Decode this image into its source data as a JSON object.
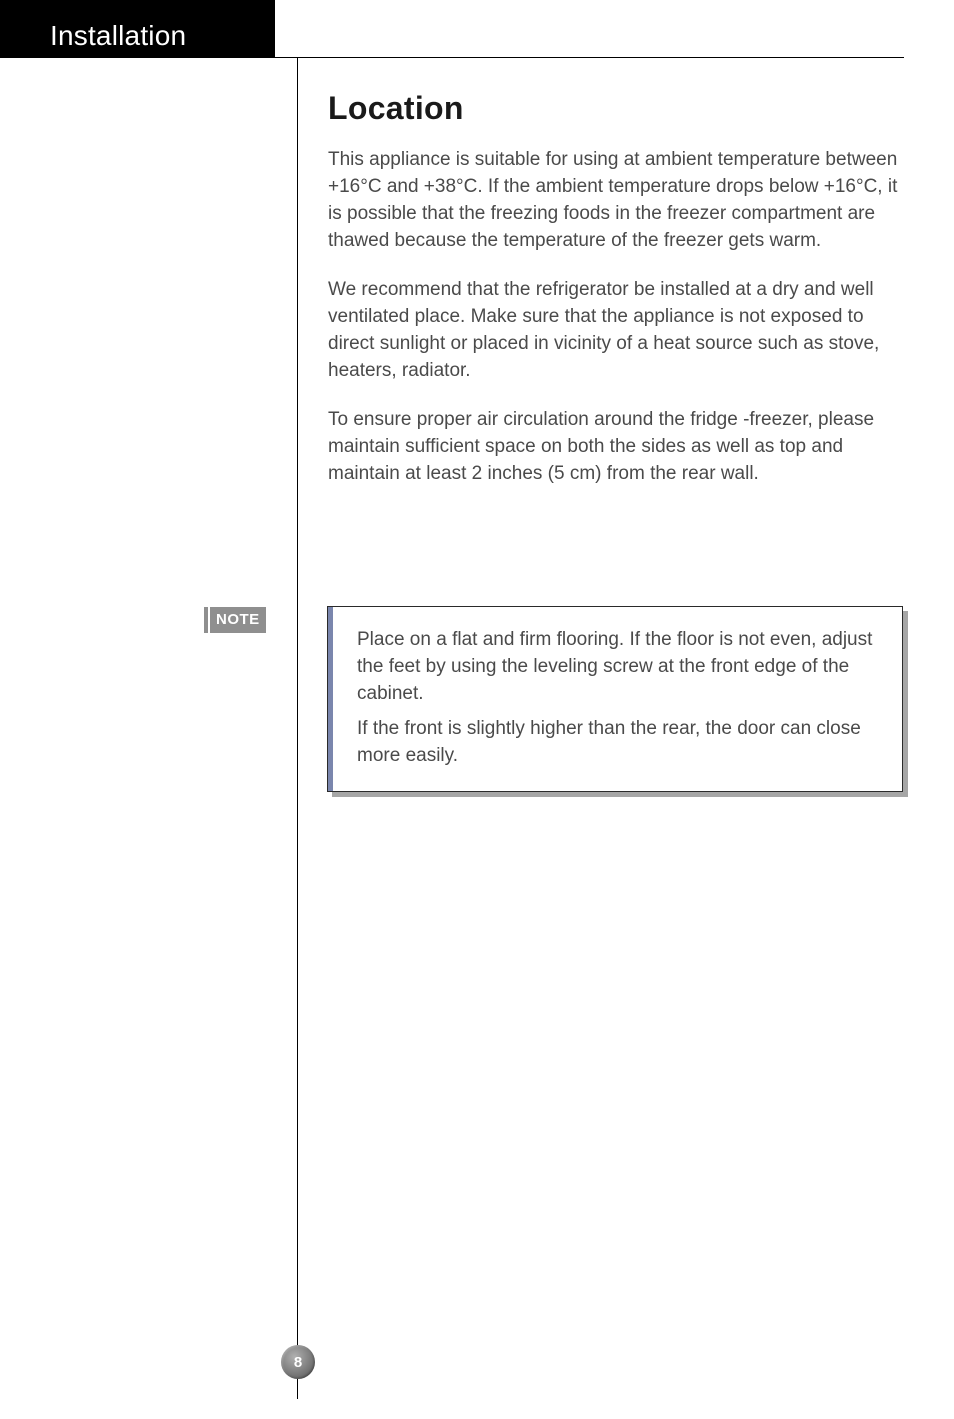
{
  "page_number": "8",
  "section_title": "Installation",
  "heading": "Location",
  "paragraphs": [
    "This appliance is suitable for using at ambient temperature between +16°C and +38°C. If the ambient temperature drops below +16°C, it is possible that the freezing foods in the freezer compartment are thawed because the temperature of the freezer gets warm.",
    "We recommend that the refrigerator be installed at a dry and well ventilated place. Make sure that the appliance is not exposed to direct sunlight or placed in vicinity of a heat source such as stove, heaters, radiator.",
    "To ensure  proper air circulation around the fridge -freezer, please maintain sufficient space on both the sides as well as top and  maintain at least  2 inches (5 cm) from the rear wall."
  ],
  "note": {
    "label": "NOTE",
    "paragraphs": [
      "Place on a flat and firm flooring. If the floor is not even, adjust the feet by using the leveling screw at the front edge of the cabinet.",
      "If the front is slightly higher than the rear, the door can close more easily."
    ]
  }
}
